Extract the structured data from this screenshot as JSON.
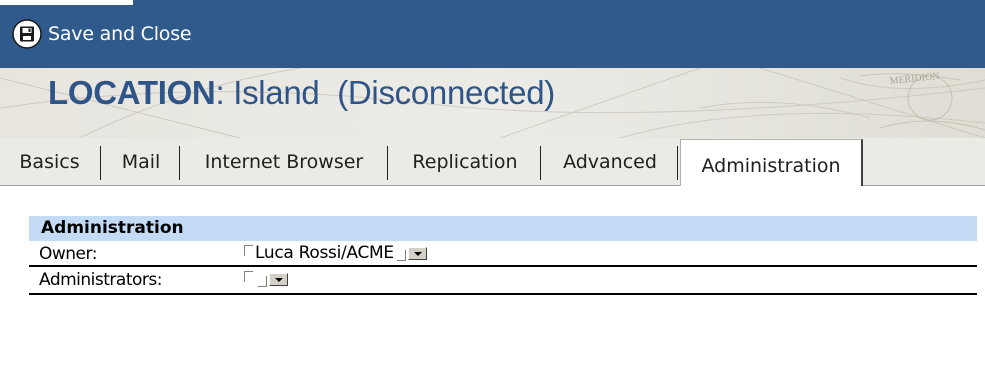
{
  "toolbar": {
    "save_close_label": "Save and Close",
    "save_icon": "floppy-disk-icon"
  },
  "header": {
    "title_key": "LOCATION",
    "title_sep": ":",
    "title_value": " Island  (Disconnected)"
  },
  "tabs": [
    {
      "label": "Basics",
      "active": false
    },
    {
      "label": "Mail",
      "active": false
    },
    {
      "label": "Internet Browser",
      "active": false
    },
    {
      "label": "Replication",
      "active": false
    },
    {
      "label": "Advanced",
      "active": false
    },
    {
      "label": "Administration",
      "active": true
    }
  ],
  "section": {
    "title": "Administration"
  },
  "fields": {
    "owner": {
      "label": "Owner:",
      "value": "Luca Rossi/ACME"
    },
    "administrators": {
      "label": "Administrators:",
      "value": ""
    }
  },
  "colors": {
    "toolbar_bg": "#315a8c",
    "title_text": "#2f5488",
    "section_header_bg": "#c3dbf5"
  }
}
